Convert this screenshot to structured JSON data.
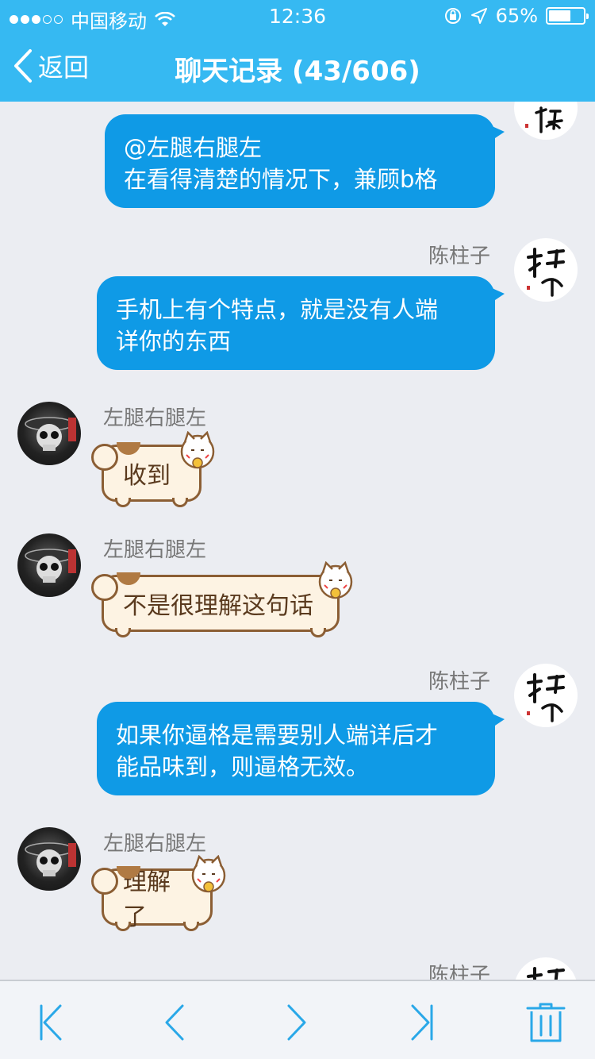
{
  "status": {
    "carrier": "中国移动",
    "time": "12:36",
    "battery": "65%",
    "battery_level": 0.65
  },
  "nav": {
    "back_label": "返回",
    "title": "聊天记录 (43/606)"
  },
  "messages": [
    {
      "side": "right",
      "sender": "",
      "text_lines": [
        "@左腿右腿左",
        "在看得清楚的情况下，兼顾b格"
      ]
    },
    {
      "side": "right",
      "sender": "陈柱子",
      "text_lines": [
        "手机上有个特点，就是没有人端",
        "详你的东西"
      ]
    },
    {
      "side": "left",
      "sender": "左腿右腿左",
      "text": "收到"
    },
    {
      "side": "left",
      "sender": "左腿右腿左",
      "text": "不是很理解这句话"
    },
    {
      "side": "right",
      "sender": "陈柱子",
      "text_lines": [
        "如果你逼格是需要别人端详后才",
        "能品味到，则逼格无效。"
      ]
    },
    {
      "side": "left",
      "sender": "左腿右腿左",
      "text": "理解了"
    },
    {
      "side": "right",
      "sender": "陈柱子"
    }
  ],
  "colors": {
    "header": "#36b9f2",
    "bubble_blue": "#0f9ae6",
    "background": "#ebedf2",
    "icon": "#2aa8e8"
  },
  "toolbar": {
    "icons": [
      "first-page-icon",
      "previous-icon",
      "next-icon",
      "last-page-icon",
      "trash-icon"
    ]
  }
}
